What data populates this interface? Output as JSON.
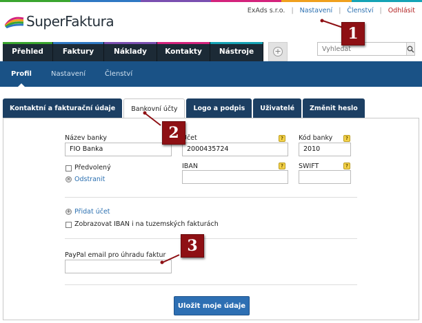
{
  "brand": {
    "name_light": "Super",
    "name_bold": "Faktura",
    "stripe_colors": [
      "#3aa52f",
      "#2f78c4",
      "#7a4fb0",
      "#d4237c",
      "#f0a01e",
      "#15a3b5"
    ]
  },
  "toplinks": {
    "company": "ExAds s.r.o.",
    "separator": "|",
    "settings": "Nastavení",
    "membership": "Členství",
    "logout": "Odhlásit"
  },
  "main_nav": [
    "Přehled",
    "Faktury",
    "Náklady",
    "Kontakty",
    "Nástroje"
  ],
  "search": {
    "placeholder": "Vyhledat"
  },
  "sub_nav": [
    "Profil",
    "Nastavení",
    "Členství"
  ],
  "tabs": [
    "Kontaktní a fakturační údaje",
    "Bankovní účty",
    "Logo a podpis",
    "Uživatelé",
    "Změnit heslo"
  ],
  "form": {
    "bank_name_label": "Název banky",
    "bank_name_value": "FIO Banka",
    "account_label": "Účet",
    "account_value": "2000435724",
    "bank_code_label": "Kód banky",
    "bank_code_value": "2010",
    "default_label": "Předvolený",
    "remove_label": "Odstranit",
    "iban_label": "IBAN",
    "iban_value": "",
    "swift_label": "SWIFT",
    "swift_value": "",
    "add_account": "Přidat účet",
    "show_iban_label": "Zobrazovat IBAN i na tuzemských fakturách",
    "paypal_label": "PayPal email pro úhradu faktur",
    "paypal_value": "",
    "save_button": "Uložit moje údaje"
  },
  "markers": [
    "1",
    "2",
    "3"
  ],
  "colors": {
    "nav_dark": "#1c2a36",
    "subnav_blue": "#1a5286",
    "tab_blue": "#1c3f63",
    "marker_red": "#8e1014",
    "save_blue": "#2d6fb3"
  }
}
